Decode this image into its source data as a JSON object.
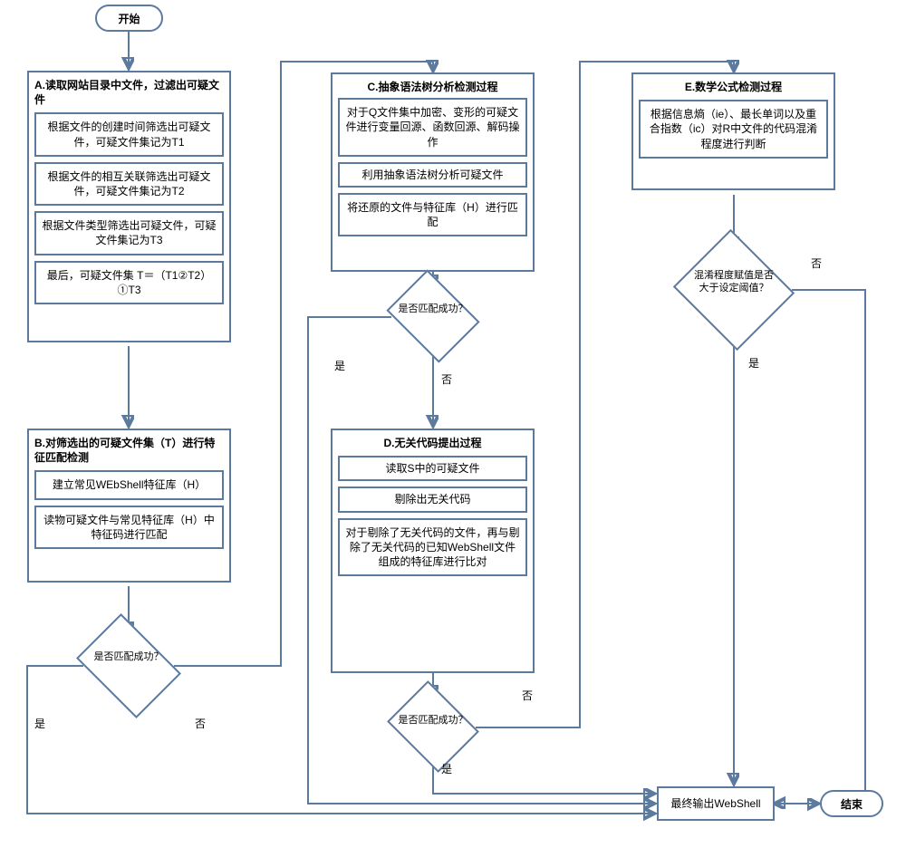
{
  "terminals": {
    "start": "开始",
    "end": "结束"
  },
  "output": "最终输出WebShell",
  "labels": {
    "yes": "是",
    "no": "否"
  },
  "A": {
    "title": "A.读取网站目录中文件，过滤出可疑文件",
    "s1": "根据文件的创建时间筛选出可疑文件，可疑文件集记为T1",
    "s2": "根据文件的相互关联筛选出可疑文件，可疑文件集记为T2",
    "s3": "根据文件类型筛选出可疑文件，可疑文件集记为T3",
    "s4": "最后，可疑文件集 T＝（T1②T2）①T3"
  },
  "B": {
    "title": "B.对筛选出的可疑文件集（T）进行特征匹配检测",
    "s1": "建立常见WEbShell特征库（H）",
    "s2": "读物可疑文件与常见特征库（H）中特征码进行匹配",
    "dec": "是否匹配成功？"
  },
  "C": {
    "title": "C.抽象语法树分析检测过程",
    "s1": "对于Q文件集中加密、变形的可疑文件进行变量回源、函数回源、解码操作",
    "s2": "利用抽象语法树分析可疑文件",
    "s3": "将还原的文件与特征库（H）进行匹配",
    "dec": "是否匹配成功？"
  },
  "D": {
    "title": "D.无关代码提出过程",
    "s1": "读取S中的可疑文件",
    "s2": "剔除出无关代码",
    "s3": "对于剔除了无关代码的文件，再与剔除了无关代码的已知WebShell文件组成的特征库进行比对",
    "dec": "是否匹配成功？"
  },
  "E": {
    "title": "E.数学公式检测过程",
    "s1": "根据信息熵（ie）、最长单词以及重合指数（ic）对R中文件的代码混淆程度进行判断",
    "dec": "混淆程度赋值是否大于设定阈值？"
  }
}
